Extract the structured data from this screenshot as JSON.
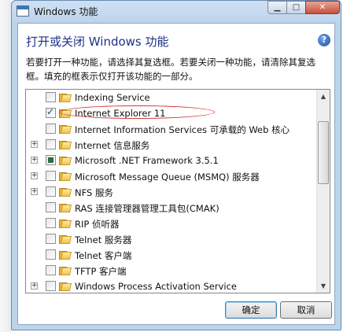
{
  "window": {
    "title": "Windows 功能",
    "controls": {
      "minimize": "▁",
      "maximize": "□",
      "close": "✕"
    }
  },
  "header": {
    "heading": "打开或关闭 Windows 功能",
    "description": "若要打开一种功能，请选择其复选框。若要关闭一种功能，请清除其复选框。填充的框表示仅打开该功能的一部分。",
    "help_icon": "?"
  },
  "features": [
    {
      "label": "Indexing Service",
      "expandable": false,
      "state": "unchecked"
    },
    {
      "label": "Internet Explorer 11",
      "expandable": false,
      "state": "checked"
    },
    {
      "label": "Internet Information Services 可承载的 Web 核心",
      "expandable": false,
      "state": "unchecked"
    },
    {
      "label": "Internet 信息服务",
      "expandable": true,
      "state": "unchecked"
    },
    {
      "label": "Microsoft .NET Framework 3.5.1",
      "expandable": true,
      "state": "partial"
    },
    {
      "label": "Microsoft Message Queue (MSMQ) 服务器",
      "expandable": true,
      "state": "unchecked"
    },
    {
      "label": "NFS 服务",
      "expandable": true,
      "state": "unchecked"
    },
    {
      "label": "RAS 连接管理器管理工具包(CMAK)",
      "expandable": false,
      "state": "unchecked"
    },
    {
      "label": "RIP 侦听器",
      "expandable": false,
      "state": "unchecked"
    },
    {
      "label": "Telnet 服务器",
      "expandable": false,
      "state": "unchecked"
    },
    {
      "label": "Telnet 客户端",
      "expandable": false,
      "state": "unchecked"
    },
    {
      "label": "TFTP 客户端",
      "expandable": false,
      "state": "unchecked"
    },
    {
      "label": "Windows Process Activation Service",
      "expandable": true,
      "state": "unchecked"
    }
  ],
  "scrollbar": {
    "up": "▲",
    "down": "▼"
  },
  "buttons": {
    "ok": "确定",
    "cancel": "取消"
  }
}
